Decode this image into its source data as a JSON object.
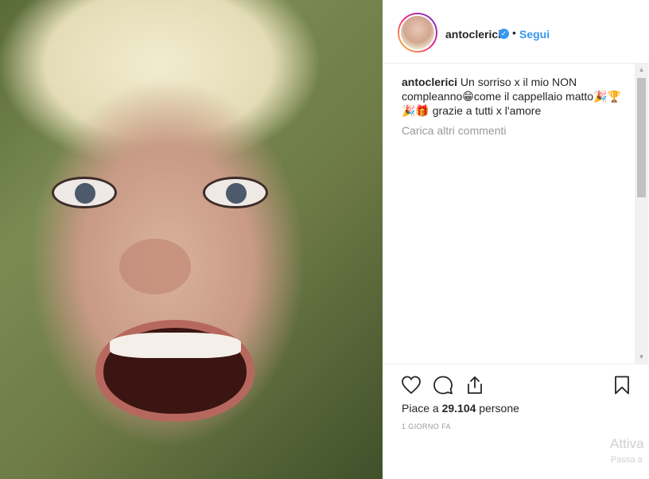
{
  "post": {
    "username": "antoclerici",
    "verified_icon": "verified-badge-icon",
    "separator": "•",
    "follow_label": "Segui",
    "caption_text": "Un sorriso x il mio NON compleanno😁come il cappellaio matto🎉🏆🎉🎁 grazie a tutti x l'amore",
    "load_more": "Carica altri commenti",
    "likes_prefix": "Piace a ",
    "likes_count": "29.104",
    "likes_suffix": " persone",
    "time_ago": "1 GIORNO FA"
  },
  "icons": {
    "like": "heart-icon",
    "comment": "comment-icon",
    "share": "share-icon",
    "save": "bookmark-icon"
  },
  "os_watermark": {
    "title": "Attiva",
    "subtitle": "Passa a"
  },
  "colors": {
    "accent": "#3897f0",
    "text": "#262626",
    "muted": "#999999"
  }
}
